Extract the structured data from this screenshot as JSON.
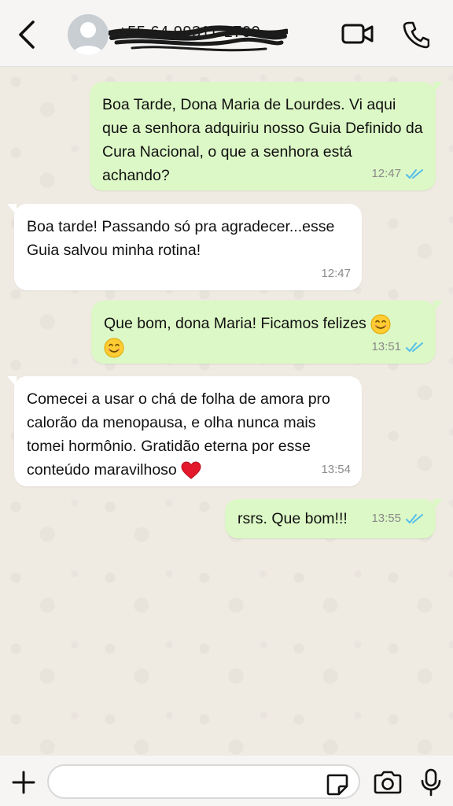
{
  "header": {
    "contact_name": "+55 64 99311-1700",
    "icons": [
      "back-arrow-icon",
      "avatar-placeholder-icon",
      "video-call-icon",
      "phone-icon"
    ]
  },
  "messages": [
    {
      "direction": "out",
      "text": "Boa Tarde, Dona Maria de Lourdes. Vi aqui que a senhora adquiriu nosso Guia Definido da Cura Nacional, o que a senhora está achando?",
      "time": "12:47",
      "status": "read"
    },
    {
      "direction": "in",
      "text": "Boa tarde! Passando só pra agradecer...esse Guia salvou minha rotina!",
      "time": "12:47"
    },
    {
      "direction": "out",
      "text": "Que bom, dona Maria! Ficamos felizes",
      "time": "13:51",
      "status": "read",
      "emoji": "smiling-face-emoji"
    },
    {
      "direction": "in",
      "text": "Comecei a usar o chá de folha de amora pro calorão da menopausa, e olha nunca mais tomei hormônio. Gratidão eterna por esse conteúdo maravilhoso",
      "time": "13:54",
      "emoji": "red-heart-emoji"
    },
    {
      "direction": "out",
      "text": "rsrs. Que bom!!!",
      "time": "13:55",
      "status": "read"
    }
  ],
  "composer": {
    "placeholder": "",
    "icons": [
      "plus-icon",
      "sticker-icon",
      "camera-icon",
      "microphone-icon"
    ]
  },
  "colors": {
    "outgoing_bubble": "#dcf8c6",
    "incoming_bubble": "#ffffff",
    "read_ticks": "#53bdeb",
    "wallpaper": "#efeae2"
  }
}
